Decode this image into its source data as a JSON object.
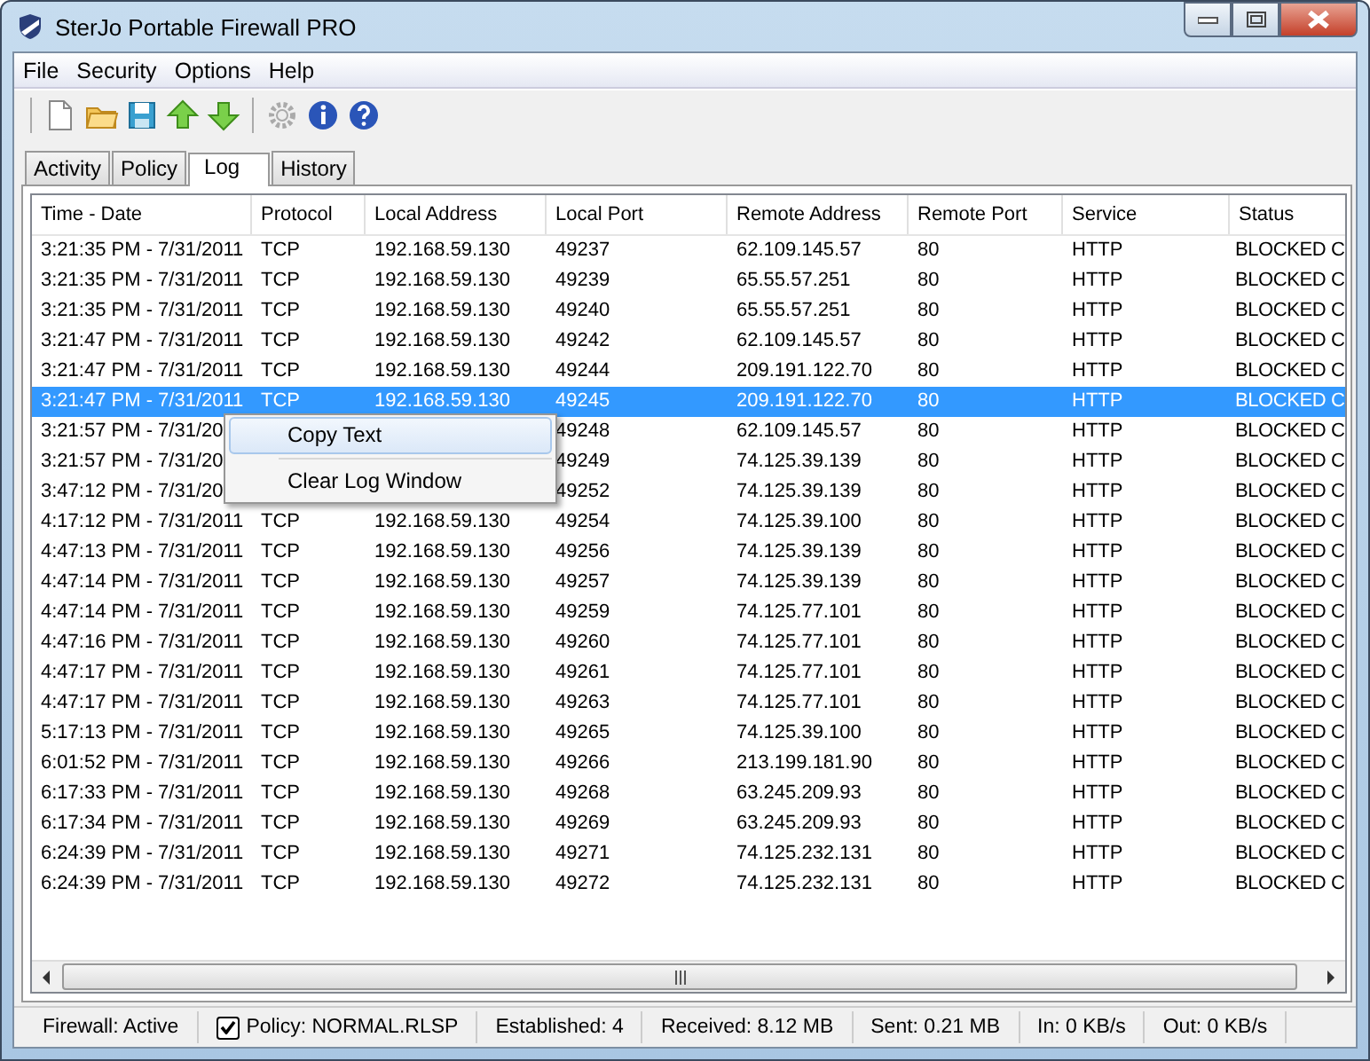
{
  "window": {
    "title": "SterJo Portable Firewall PRO"
  },
  "menu_bar": [
    "File",
    "Security",
    "Options",
    "Help"
  ],
  "tabs": [
    {
      "label": "Activity",
      "selected": false
    },
    {
      "label": "Policy",
      "selected": false
    },
    {
      "label": "Log",
      "selected": true
    },
    {
      "label": "History",
      "selected": false
    }
  ],
  "table": {
    "columns": [
      "Time - Date",
      "Protocol",
      "Local Address",
      "Local Port",
      "Remote Address",
      "Remote Port",
      "Service",
      "Status"
    ],
    "rows": [
      {
        "selected": false,
        "cells": [
          "3:21:35 PM - 7/31/2011",
          "TCP",
          "192.168.59.130",
          "49237",
          "62.109.145.57",
          "80",
          "HTTP",
          "BLOCKED C"
        ]
      },
      {
        "selected": false,
        "cells": [
          "3:21:35 PM - 7/31/2011",
          "TCP",
          "192.168.59.130",
          "49239",
          "65.55.57.251",
          "80",
          "HTTP",
          "BLOCKED C"
        ]
      },
      {
        "selected": false,
        "cells": [
          "3:21:35 PM - 7/31/2011",
          "TCP",
          "192.168.59.130",
          "49240",
          "65.55.57.251",
          "80",
          "HTTP",
          "BLOCKED C"
        ]
      },
      {
        "selected": false,
        "cells": [
          "3:21:47 PM - 7/31/2011",
          "TCP",
          "192.168.59.130",
          "49242",
          "62.109.145.57",
          "80",
          "HTTP",
          "BLOCKED C"
        ]
      },
      {
        "selected": false,
        "cells": [
          "3:21:47 PM - 7/31/2011",
          "TCP",
          "192.168.59.130",
          "49244",
          "209.191.122.70",
          "80",
          "HTTP",
          "BLOCKED C"
        ]
      },
      {
        "selected": true,
        "cells": [
          "3:21:47 PM - 7/31/2011",
          "TCP",
          "192.168.59.130",
          "49245",
          "209.191.122.70",
          "80",
          "HTTP",
          "BLOCKED C"
        ]
      },
      {
        "selected": false,
        "cells": [
          "3:21:57 PM - 7/31/20",
          null,
          null,
          "49248",
          "62.109.145.57",
          "80",
          "HTTP",
          "BLOCKED C"
        ]
      },
      {
        "selected": false,
        "cells": [
          "3:21:57 PM - 7/31/20",
          null,
          null,
          "49249",
          "74.125.39.139",
          "80",
          "HTTP",
          "BLOCKED C"
        ]
      },
      {
        "selected": false,
        "cells": [
          "3:47:12 PM - 7/31/20",
          null,
          null,
          "49252",
          "74.125.39.139",
          "80",
          "HTTP",
          "BLOCKED C"
        ]
      },
      {
        "selected": false,
        "cells": [
          "4:17:12 PM - 7/31/2011",
          "TCP",
          "192.168.59.130",
          "49254",
          "74.125.39.100",
          "80",
          "HTTP",
          "BLOCKED C"
        ]
      },
      {
        "selected": false,
        "cells": [
          "4:47:13 PM - 7/31/2011",
          "TCP",
          "192.168.59.130",
          "49256",
          "74.125.39.139",
          "80",
          "HTTP",
          "BLOCKED C"
        ]
      },
      {
        "selected": false,
        "cells": [
          "4:47:14 PM - 7/31/2011",
          "TCP",
          "192.168.59.130",
          "49257",
          "74.125.39.139",
          "80",
          "HTTP",
          "BLOCKED C"
        ]
      },
      {
        "selected": false,
        "cells": [
          "4:47:14 PM - 7/31/2011",
          "TCP",
          "192.168.59.130",
          "49259",
          "74.125.77.101",
          "80",
          "HTTP",
          "BLOCKED C"
        ]
      },
      {
        "selected": false,
        "cells": [
          "4:47:16 PM - 7/31/2011",
          "TCP",
          "192.168.59.130",
          "49260",
          "74.125.77.101",
          "80",
          "HTTP",
          "BLOCKED C"
        ]
      },
      {
        "selected": false,
        "cells": [
          "4:47:17 PM - 7/31/2011",
          "TCP",
          "192.168.59.130",
          "49261",
          "74.125.77.101",
          "80",
          "HTTP",
          "BLOCKED C"
        ]
      },
      {
        "selected": false,
        "cells": [
          "4:47:17 PM - 7/31/2011",
          "TCP",
          "192.168.59.130",
          "49263",
          "74.125.77.101",
          "80",
          "HTTP",
          "BLOCKED C"
        ]
      },
      {
        "selected": false,
        "cells": [
          "5:17:13 PM - 7/31/2011",
          "TCP",
          "192.168.59.130",
          "49265",
          "74.125.39.100",
          "80",
          "HTTP",
          "BLOCKED C"
        ]
      },
      {
        "selected": false,
        "cells": [
          "6:01:52 PM - 7/31/2011",
          "TCP",
          "192.168.59.130",
          "49266",
          "213.199.181.90",
          "80",
          "HTTP",
          "BLOCKED C"
        ]
      },
      {
        "selected": false,
        "cells": [
          "6:17:33 PM - 7/31/2011",
          "TCP",
          "192.168.59.130",
          "49268",
          "63.245.209.93",
          "80",
          "HTTP",
          "BLOCKED C"
        ]
      },
      {
        "selected": false,
        "cells": [
          "6:17:34 PM - 7/31/2011",
          "TCP",
          "192.168.59.130",
          "49269",
          "63.245.209.93",
          "80",
          "HTTP",
          "BLOCKED C"
        ]
      },
      {
        "selected": false,
        "cells": [
          "6:24:39 PM - 7/31/2011",
          "TCP",
          "192.168.59.130",
          "49271",
          "74.125.232.131",
          "80",
          "HTTP",
          "BLOCKED C"
        ]
      },
      {
        "selected": false,
        "cells": [
          "6:24:39 PM - 7/31/2011",
          "TCP",
          "192.168.59.130",
          "49272",
          "74.125.232.131",
          "80",
          "HTTP",
          "BLOCKED C"
        ]
      }
    ]
  },
  "context_menu": [
    {
      "label": "Copy Text",
      "selected": true
    },
    {
      "label": "Clear Log Window",
      "selected": false
    }
  ],
  "status_bar": [
    {
      "kind": "text",
      "label": "Firewall: Active"
    },
    {
      "kind": "checkbox",
      "label": "Policy: NORMAL.RLSP",
      "checked": true
    },
    {
      "kind": "text",
      "label": "Established: 4"
    },
    {
      "kind": "text",
      "label": "Received: 8.12 MB"
    },
    {
      "kind": "text",
      "label": "Sent: 0.21 MB"
    },
    {
      "kind": "text",
      "label": "In: 0 KB/s"
    },
    {
      "kind": "text",
      "label": "Out: 0 KB/s"
    }
  ]
}
